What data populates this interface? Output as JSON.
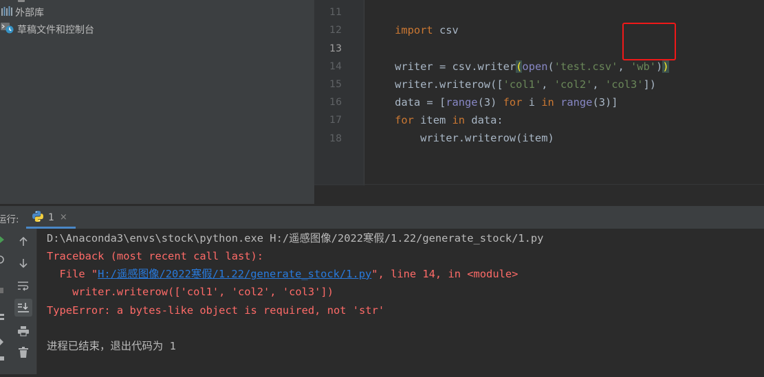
{
  "project_tree": {
    "items": [
      {
        "label": "外部库",
        "icon": "library-icon"
      },
      {
        "label": "草稿文件和控制台",
        "icon": "scratches-icon"
      }
    ]
  },
  "editor": {
    "line_numbers": [
      "11",
      "12",
      "13",
      "14",
      "15",
      "16",
      "17",
      "18"
    ],
    "current_line": "13",
    "code": {
      "l11": {
        "kw": "import",
        "rest": " csv"
      },
      "l13": {
        "p1": "writer = csv.writer",
        "paren_open": "(",
        "builtin": "open",
        "p2": "(",
        "s1": "'test.csv'",
        "p3": ", ",
        "s2": "'wb'",
        "p4": ")",
        "paren_close": ")"
      },
      "l14": {
        "p1": "writer.writerow([",
        "s1": "'col1'",
        "p2": ", ",
        "s2": "'col2'",
        "p3": ", ",
        "s3": "'col3'",
        "p4": "])"
      },
      "l15": {
        "p1": "data = [",
        "b1": "range",
        "p2": "(3) ",
        "k1": "for",
        "p3": " i ",
        "k2": "in",
        "p4": " ",
        "b2": "range",
        "p5": "(3)]"
      },
      "l16": {
        "k1": "for",
        "p1": " item ",
        "k2": "in",
        "p2": " data:"
      },
      "l17": {
        "text": "    writer.writerow(item)"
      }
    }
  },
  "run_window": {
    "label": "运行:",
    "tab_label": "1",
    "close_glyph": "×",
    "toolbar_icons": [
      "rerun-up-icon",
      "rerun-down-icon",
      "soft-wrap-icon",
      "scroll-to-end-icon",
      "print-icon",
      "trash-icon"
    ],
    "console": {
      "command": "D:\\Anaconda3\\envs\\stock\\python.exe H:/遥感图像/2022寒假/1.22/generate_stock/1.py",
      "traceback": "Traceback (most recent call last):",
      "file_prefix": "  File \"",
      "file_link": "H:/遥感图像/2022寒假/1.22/generate_stock/1.py",
      "file_suffix": "\", line 14, in <module>",
      "source_line": "    writer.writerow(['col1', 'col2', 'col3'])",
      "error": "TypeError: a bytes-like object is required, not 'str'",
      "exit_message": "进程已结束，退出代码为 1"
    }
  },
  "colors": {
    "editor_bg": "#2b2b2b",
    "panel_bg": "#3c3f41",
    "keyword": "#cc7832",
    "string": "#6a8759",
    "builtin": "#8888c6",
    "error_text": "#ff6b68",
    "link": "#287bde",
    "highlight_box": "#f01818"
  }
}
